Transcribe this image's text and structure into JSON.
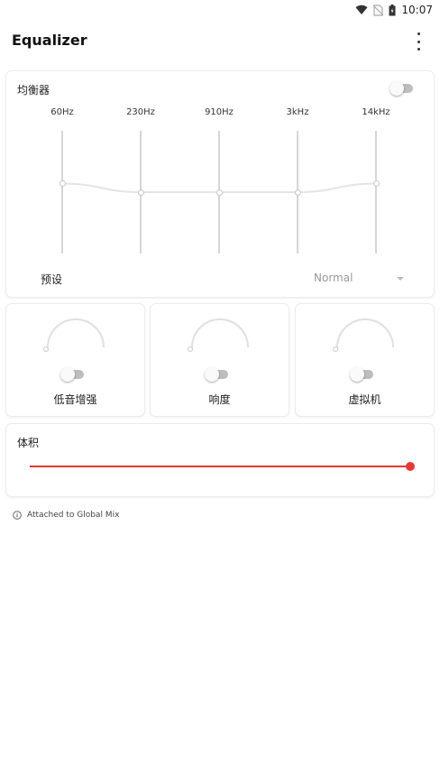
{
  "status": {
    "time": "10:07",
    "icons": [
      "wifi-icon",
      "no-sim-icon",
      "battery-icon"
    ]
  },
  "app": {
    "title": "Equalizer",
    "menu_icon": "more-vert-icon"
  },
  "equalizer": {
    "title": "均衡器",
    "enabled": false,
    "bands": [
      {
        "label": "60Hz",
        "level": 0.57
      },
      {
        "label": "230Hz",
        "level": 0.5
      },
      {
        "label": "910Hz",
        "level": 0.5
      },
      {
        "label": "3kHz",
        "level": 0.5
      },
      {
        "label": "14kHz",
        "level": 0.57
      }
    ],
    "preset_label": "预设",
    "preset_value": "Normal"
  },
  "effects": [
    {
      "label": "低音增强",
      "enabled": false,
      "level": 0
    },
    {
      "label": "响度",
      "enabled": false,
      "level": 0
    },
    {
      "label": "虚拟机",
      "enabled": false,
      "level": 0
    }
  ],
  "volume": {
    "label": "体积",
    "level": 1.0
  },
  "footer": {
    "icon": "info-icon",
    "text": "Attached to Global Mix"
  },
  "colors": {
    "accent": "#e53935",
    "toggle_off_track": "#bdbdbd",
    "eq_track": "#d6d6d6",
    "muted_text": "#999999"
  }
}
